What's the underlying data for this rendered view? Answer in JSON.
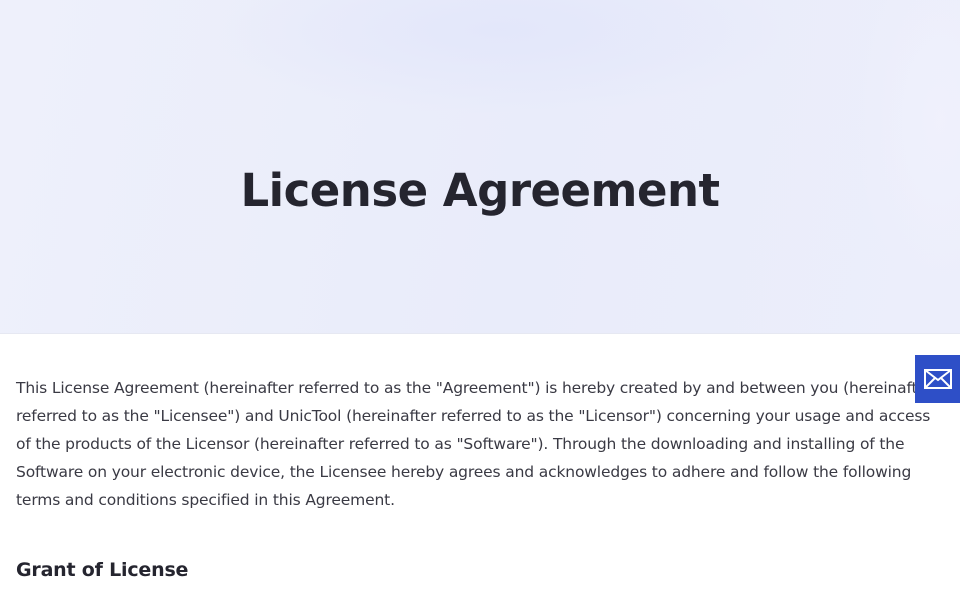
{
  "hero": {
    "title": "License Agreement"
  },
  "content": {
    "intro": "This License Agreement (hereinafter referred to as the \"Agreement\") is hereby created by and between you (hereinafter referred to as the \"Licensee\") and UnicTool (hereinafter referred to as the \"Licensor\") concerning your usage and access of the products of the Licensor (hereinafter referred to as \"Software\"). Through the downloading and installing of the Software on your electronic device, the Licensee hereby agrees and acknowledges to adhere and follow the following terms and conditions specified in this Agreement.",
    "section_heading": "Grant of License"
  },
  "contact_tab": {
    "icon": "mail-icon",
    "color": "#2e4fc7"
  }
}
